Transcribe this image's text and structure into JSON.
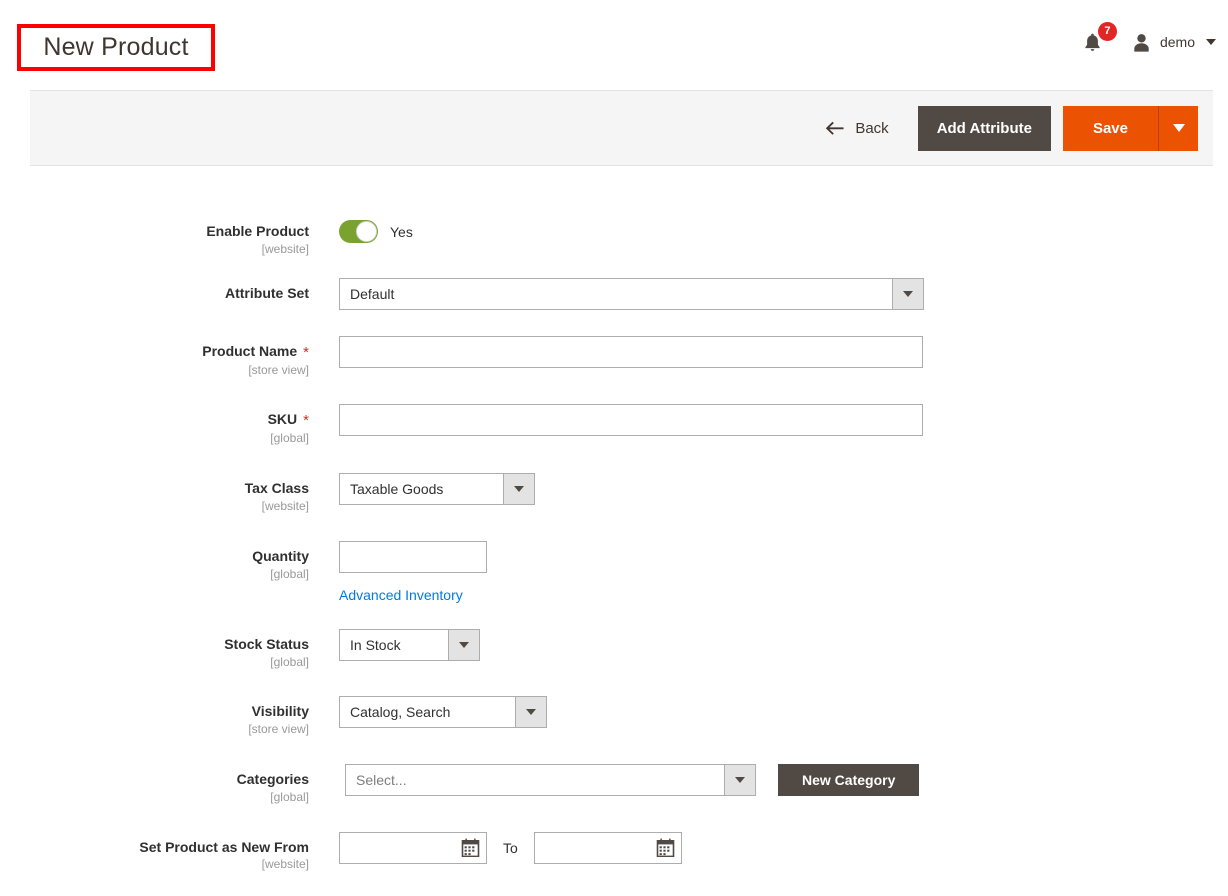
{
  "header": {
    "page_title": "New Product",
    "notifications": {
      "icon": "bell-icon",
      "count": "7"
    },
    "user": {
      "icon": "user-avatar-icon",
      "name": "demo"
    }
  },
  "toolbar": {
    "back_label": "Back",
    "add_attribute_label": "Add Attribute",
    "save_label": "Save",
    "save_menu_icon": "chevron-down-icon"
  },
  "form": {
    "enable_product": {
      "label": "Enable Product",
      "scope": "[website]",
      "toggle_state": "Yes"
    },
    "attribute_set": {
      "label": "Attribute Set",
      "scope": "",
      "value": "Default"
    },
    "product_name": {
      "label": "Product Name",
      "scope": "[store view]",
      "required": "*",
      "value": "",
      "placeholder": ""
    },
    "sku": {
      "label": "SKU",
      "scope": "[global]",
      "required": "*",
      "value": "",
      "placeholder": ""
    },
    "tax_class": {
      "label": "Tax Class",
      "scope": "[website]",
      "value": "Taxable Goods"
    },
    "quantity": {
      "label": "Quantity",
      "scope": "[global]",
      "value": "",
      "placeholder": "",
      "advanced_inventory_link": "Advanced Inventory"
    },
    "stock_status": {
      "label": "Stock Status",
      "scope": "[global]",
      "value": "In Stock"
    },
    "visibility": {
      "label": "Visibility",
      "scope": "[store view]",
      "value": "Catalog, Search"
    },
    "categories": {
      "label": "Categories",
      "scope": "[global]",
      "value": "Select...",
      "new_category_button": "New Category"
    },
    "set_new_from": {
      "label": "Set Product as New From",
      "scope": "[website]",
      "from_value": "",
      "to_label": "To",
      "to_value": "",
      "calendar_icon": "calendar-icon"
    }
  },
  "colors": {
    "accent_orange": "#eb5202",
    "dark_button": "#514943",
    "toggle_green": "#79a22e",
    "link_blue": "#007bdb",
    "badge_red": "#e22626",
    "highlight_red": "#ff0000"
  }
}
